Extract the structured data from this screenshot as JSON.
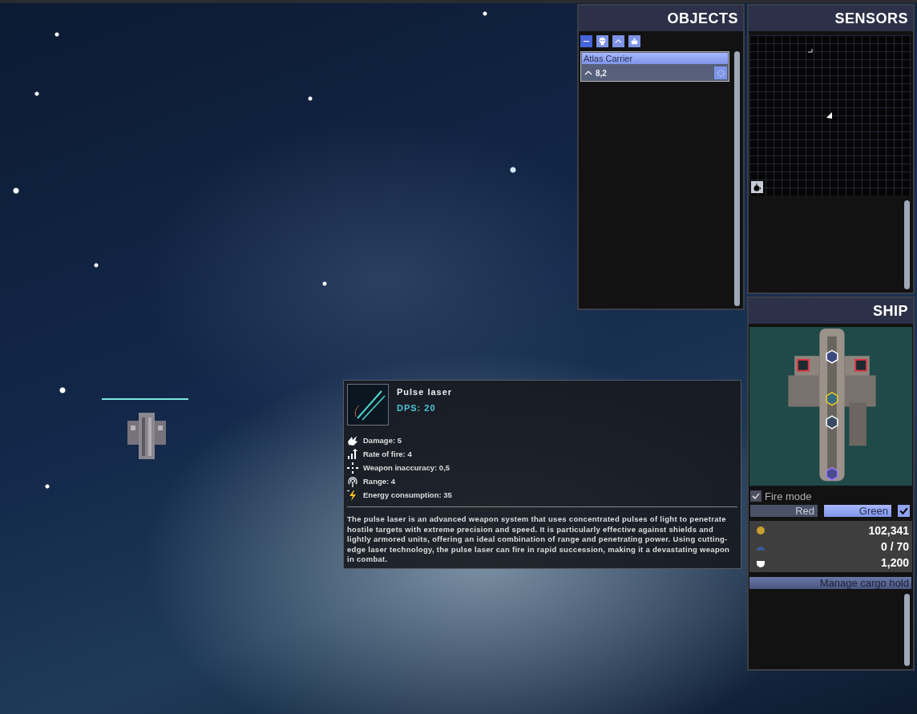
{
  "scene": {
    "health_bar": {
      "level": 1
    }
  },
  "objects": {
    "title": "OBJECTS",
    "filters": [
      {
        "kind": "minus",
        "selected": true
      },
      {
        "kind": "skull",
        "selected": false
      },
      {
        "kind": "chevron",
        "selected": false
      },
      {
        "kind": "ship",
        "selected": false
      }
    ],
    "items": [
      {
        "name": "Atlas Carrier",
        "value": "8,2",
        "selected": true
      }
    ]
  },
  "sensors": {
    "title": "SENSORS"
  },
  "ship": {
    "title": "SHIP",
    "fire_mode": {
      "label": "Fire mode",
      "checked": true
    },
    "modes": [
      {
        "label": "Red",
        "selected": false
      },
      {
        "label": "Green",
        "selected": true
      }
    ],
    "mode_toggle": {
      "checked": true
    },
    "stats": [
      {
        "kind": "credits",
        "value": "102,341"
      },
      {
        "kind": "crew",
        "value": "0 / 70"
      },
      {
        "kind": "fuel",
        "value": "1,200"
      }
    ],
    "cargo_button": "Manage cargo hold"
  },
  "tooltip": {
    "title": "Pulse laser",
    "dps": "DPS: 20",
    "stats": [
      {
        "kind": "damage",
        "text": "Damage: 5"
      },
      {
        "kind": "rate",
        "text": "Rate of fire: 4"
      },
      {
        "kind": "inaccuracy",
        "text": "Weapon inaccuracy: 0,5"
      },
      {
        "kind": "range",
        "text": "Range: 4"
      },
      {
        "kind": "energy",
        "text": "Energy consumption: 35"
      }
    ],
    "description": "The pulse laser is an advanced weapon system that uses concentrated pulses of light to penetrate hostile targets with extreme precision and speed. It is particularly effective against shields and lightly armored units, offering an ideal combination of range and penetrating power. Using cutting-edge laser technology, the pulse laser can fire in rapid succession, making it a devastating weapon in combat."
  }
}
